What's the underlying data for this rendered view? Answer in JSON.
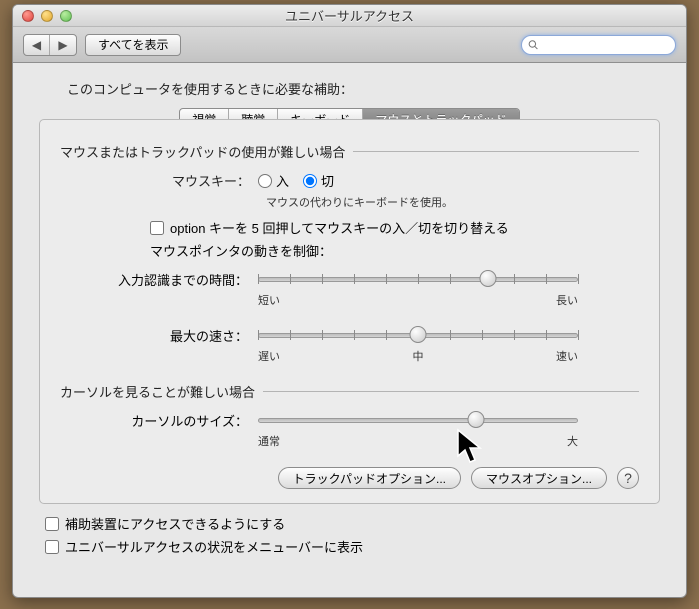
{
  "window": {
    "title": "ユニバーサルアクセス"
  },
  "toolbar": {
    "show_all": "すべてを表示"
  },
  "intro": "このコンピュータを使用するときに必要な補助：",
  "tabs": {
    "sight": "視覚",
    "hearing": "聴覚",
    "keyboard": "キーボード",
    "mouse": "マウスとトラックパッド"
  },
  "section1": {
    "header": "マウスまたはトラックパッドの使用が難しい場合",
    "mousekeys_label": "マウスキー：",
    "on": "入",
    "off": "切",
    "mousekeys_hint": "マウスの代わりにキーボードを使用。",
    "option_toggle": "option キーを 5 回押してマウスキーの入／切を切り替える",
    "control_label": "マウスポインタの動きを制御：",
    "delay_label": "入力認識までの時間：",
    "delay_left": "短い",
    "delay_right": "長い",
    "speed_label": "最大の速さ：",
    "speed_left": "遅い",
    "speed_mid": "中",
    "speed_right": "速い"
  },
  "section2": {
    "header": "カーソルを見ることが難しい場合",
    "size_label": "カーソルのサイズ：",
    "size_left": "通常",
    "size_right": "大"
  },
  "buttons": {
    "trackpad": "トラックパッドオプション...",
    "mouse": "マウスオプション..."
  },
  "footer": {
    "assistive": "補助装置にアクセスできるようにする",
    "menubar": "ユニバーサルアクセスの状況をメニューバーに表示"
  },
  "sliders": {
    "delay": 0.72,
    "speed": 0.5,
    "cursor": 0.68
  }
}
